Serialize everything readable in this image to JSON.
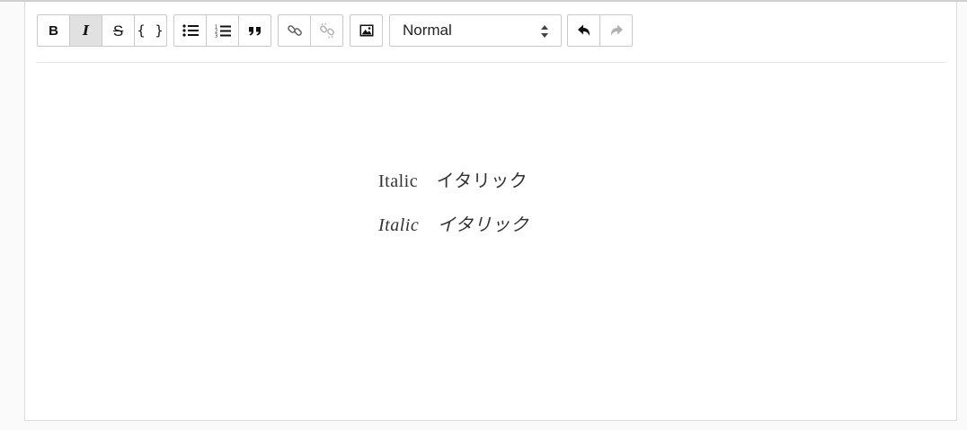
{
  "toolbar": {
    "bold_label": "B",
    "italic_label": "I",
    "strike_label": "S",
    "code_label": "{ }",
    "block_type": "Normal"
  },
  "editor": {
    "lines": [
      {
        "text": "Italic　イタリック",
        "style": "normal"
      },
      {
        "text": "Italic　イタリック",
        "style": "italic"
      }
    ]
  },
  "icons": [
    "bold-icon",
    "italic-icon",
    "strikethrough-icon",
    "code-icon",
    "bullet-list-icon",
    "numbered-list-icon",
    "blockquote-icon",
    "link-icon",
    "unlink-icon",
    "image-icon",
    "undo-icon",
    "redo-icon"
  ],
  "colors": {
    "active_button": "#e1e1e1",
    "border": "#c9c9c9",
    "text": "#333333"
  }
}
